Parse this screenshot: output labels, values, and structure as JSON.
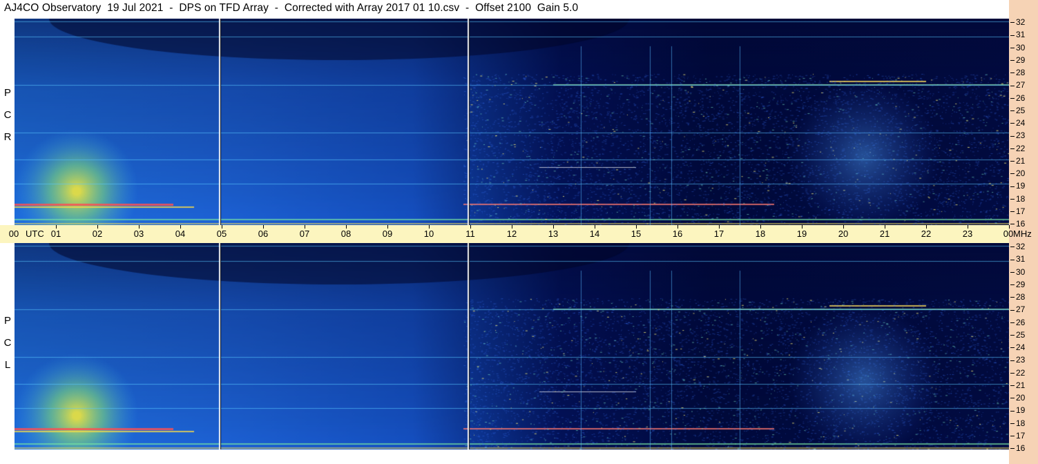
{
  "header": {
    "title": "AJ4CO Observatory  19 Jul 2021  -  DPS on TFD Array  -  Corrected with Array 2017 01 10.csv  -  Offset 2100  Gain 5.0"
  },
  "panels": {
    "top": {
      "letters": [
        "R",
        "C",
        "P"
      ]
    },
    "bottom": {
      "letters": [
        "L",
        "C",
        "P"
      ]
    }
  },
  "time_axis": {
    "start_label": "00",
    "utc_label": "UTC",
    "unit_label": "MHz",
    "ticks": [
      "01",
      "02",
      "03",
      "04",
      "05",
      "06",
      "07",
      "08",
      "09",
      "10",
      "11",
      "12",
      "13",
      "14",
      "15",
      "16",
      "17",
      "18",
      "19",
      "20",
      "21",
      "22",
      "23",
      "00"
    ]
  },
  "freq_axis": {
    "ticks": [
      "32",
      "31",
      "30",
      "29",
      "28",
      "27",
      "26",
      "25",
      "24",
      "23",
      "22",
      "21",
      "20",
      "19",
      "18",
      "17",
      "16"
    ]
  },
  "colors": {
    "background": "#ffffff",
    "right_strip": "#f6d3b5",
    "time_band": "#fcf5bf",
    "spectrogram_bright": "#1f6fe0",
    "spectrogram_dark": "#020c45"
  }
}
